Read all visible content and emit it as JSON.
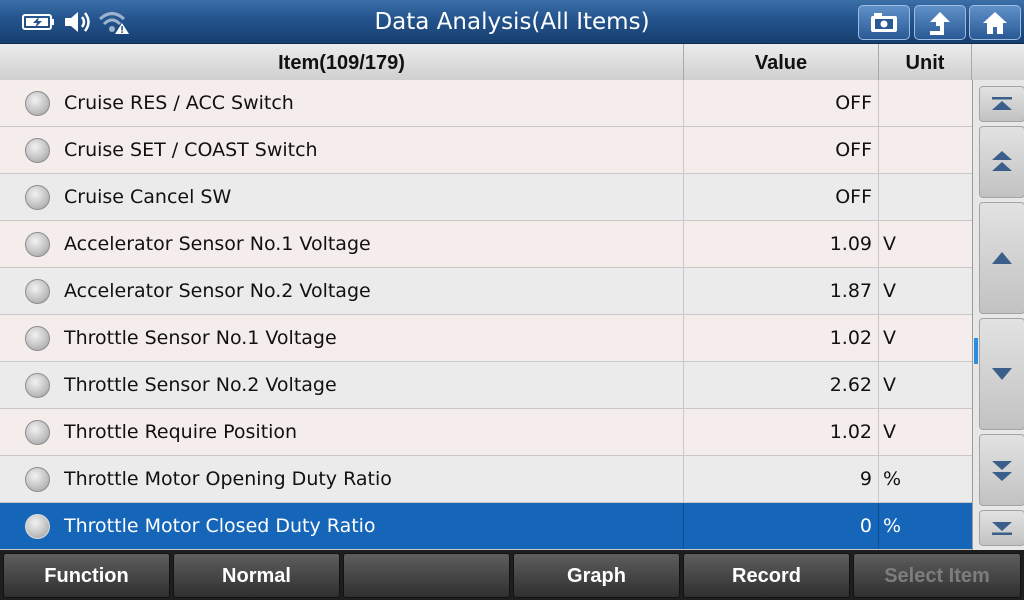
{
  "header": {
    "title": "Data Analysis(All Items)"
  },
  "status": {
    "icons": [
      "battery-icon",
      "speaker-icon",
      "wifi-warning-icon"
    ]
  },
  "toolbar": {
    "buttons": [
      "screenshot-icon",
      "back-up-icon",
      "home-icon"
    ]
  },
  "table": {
    "columns": {
      "item": "Item(109/179)",
      "value": "Value",
      "unit": "Unit"
    },
    "rows": [
      {
        "item": "Cruise RES / ACC Switch",
        "value": "OFF",
        "unit": ""
      },
      {
        "item": "Cruise SET / COAST Switch",
        "value": "OFF",
        "unit": ""
      },
      {
        "item": "Cruise Cancel SW",
        "value": "OFF",
        "unit": ""
      },
      {
        "item": "Accelerator Sensor No.1 Voltage",
        "value": "1.09",
        "unit": "V"
      },
      {
        "item": "Accelerator Sensor No.2 Voltage",
        "value": "1.87",
        "unit": "V"
      },
      {
        "item": "Throttle Sensor No.1 Voltage",
        "value": "1.02",
        "unit": "V"
      },
      {
        "item": "Throttle Sensor No.2 Voltage",
        "value": "2.62",
        "unit": "V"
      },
      {
        "item": "Throttle Require Position",
        "value": "1.02",
        "unit": "V"
      },
      {
        "item": "Throttle Motor Opening Duty Ratio",
        "value": "9",
        "unit": "%"
      },
      {
        "item": "Throttle Motor Closed Duty Ratio",
        "value": "0",
        "unit": "%"
      }
    ],
    "selected_index": 9
  },
  "scroll": {
    "buttons": [
      "scroll-top-icon",
      "page-up-icon",
      "line-up-icon",
      "line-down-icon",
      "page-down-icon",
      "scroll-bottom-icon"
    ]
  },
  "footer": {
    "function": "Function",
    "normal": "Normal",
    "empty": "",
    "graph": "Graph",
    "record": "Record",
    "select_item": "Select Item"
  },
  "colors": {
    "title_bar": "#23538c",
    "selected_row": "#1565b8",
    "scroll_indicator": "#2a8de0"
  }
}
